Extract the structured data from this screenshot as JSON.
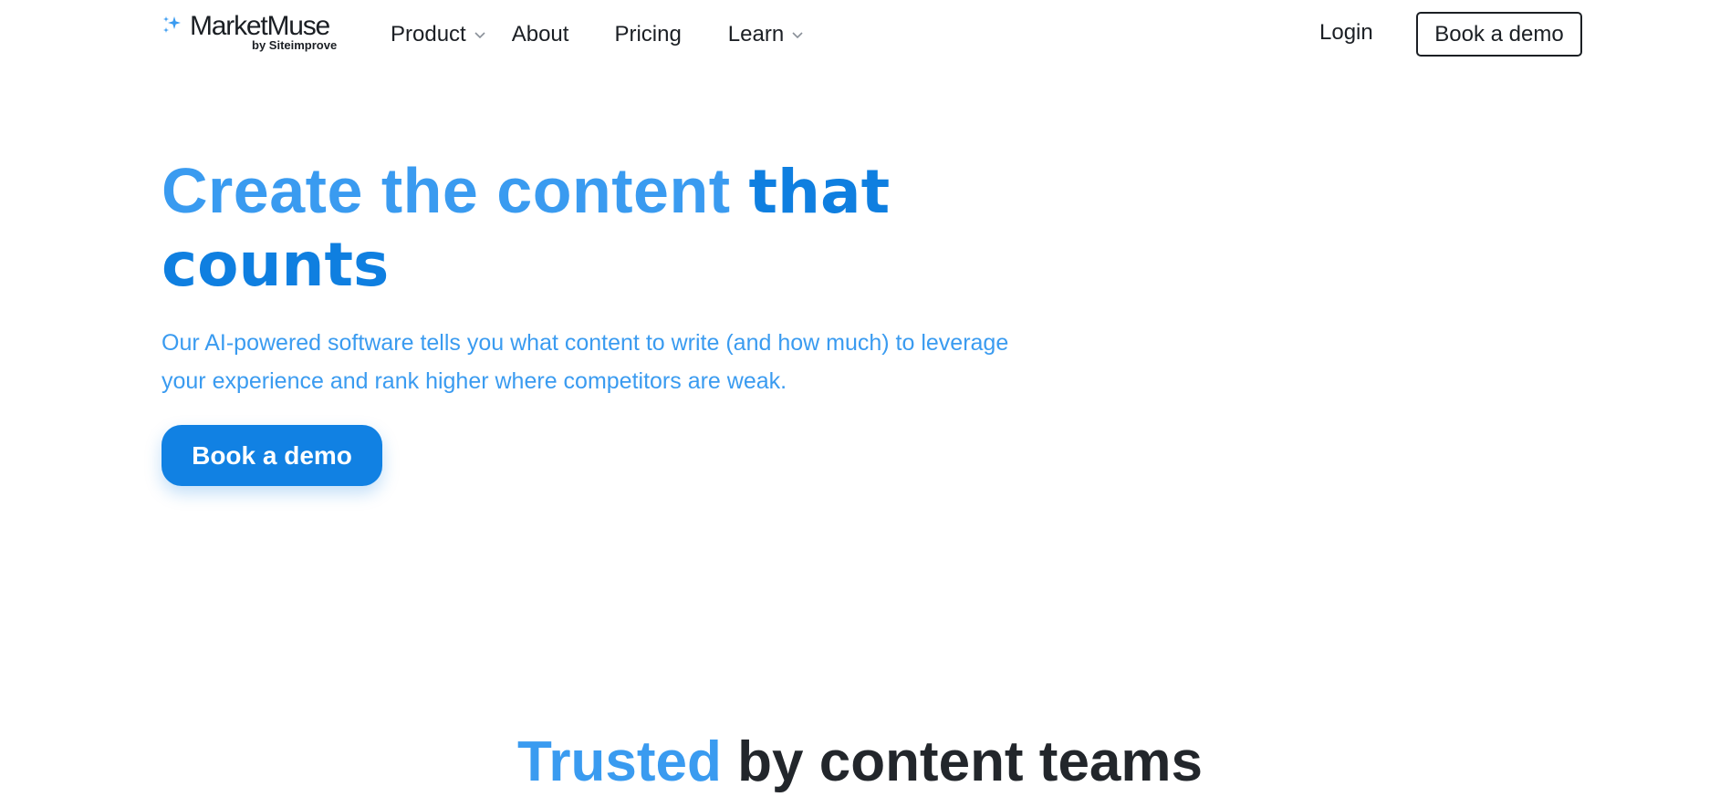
{
  "header": {
    "logo": {
      "name": "MarketMuse",
      "byline": "by Siteimprove"
    },
    "nav": {
      "product": "Product",
      "about": "About",
      "pricing": "Pricing",
      "learn": "Learn"
    },
    "login": "Login",
    "demo_button": "Book a demo"
  },
  "hero": {
    "title_light": "Create the content ",
    "title_dark": "that counts",
    "subtitle": "Our AI-powered software tells you what content to write (and how much) to leverage your experience and rank higher where competitors are weak.",
    "cta": "Book a demo"
  },
  "trusted": {
    "accent": "Trusted",
    "rest": " by content teams"
  },
  "colors": {
    "accent_light": "#3a9bf0",
    "accent_dark": "#0f7fe0",
    "cta_bg": "#1181e3",
    "text": "#1b1f24"
  },
  "icons": {
    "logo_mark": "sparkle-icon",
    "dropdown": "chevron-down-icon"
  }
}
